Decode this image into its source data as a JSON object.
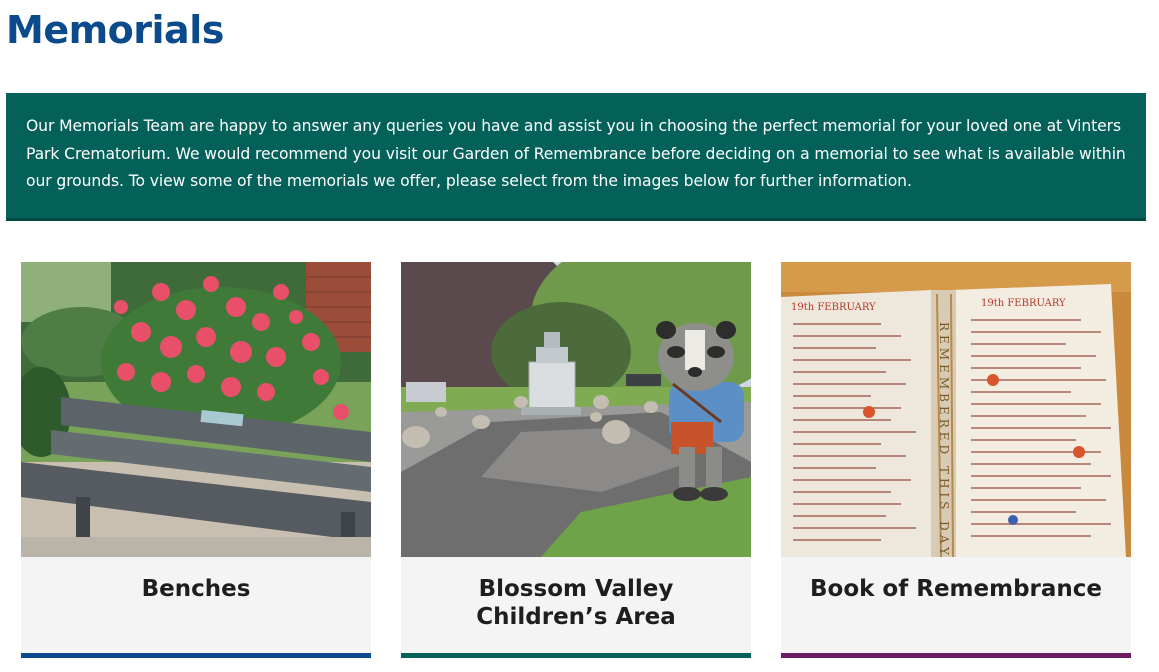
{
  "page": {
    "title": "Memorials",
    "intro": "Our Memorials Team are happy to answer any queries you have and assist you in choosing the perfect memorial for your loved one at Vinters Park Crematorium. We would recommend you visit our Garden of Remembrance before deciding on a memorial to see what is available within our grounds. To view some of the memorials we offer, please select from the images below for further information."
  },
  "colors": {
    "title": "#0b4a8b",
    "intro_bg": "#036159"
  },
  "cards": [
    {
      "label": "Benches",
      "accent": "#0b4a8b",
      "image": "memorial-bench-in-garden"
    },
    {
      "label": "Blossom Valley Children’s Area",
      "accent": "#036159",
      "image": "childrens-area-with-badger-statue"
    },
    {
      "label": "Book of Remembrance",
      "accent": "#6b1d63",
      "image": "open-book-of-remembrance"
    }
  ],
  "book_image": {
    "left_page_heading": "19th FEBRUARY",
    "right_page_heading": "19th FEBRUARY",
    "spine_text": "REMEMBERED THIS DAY"
  }
}
